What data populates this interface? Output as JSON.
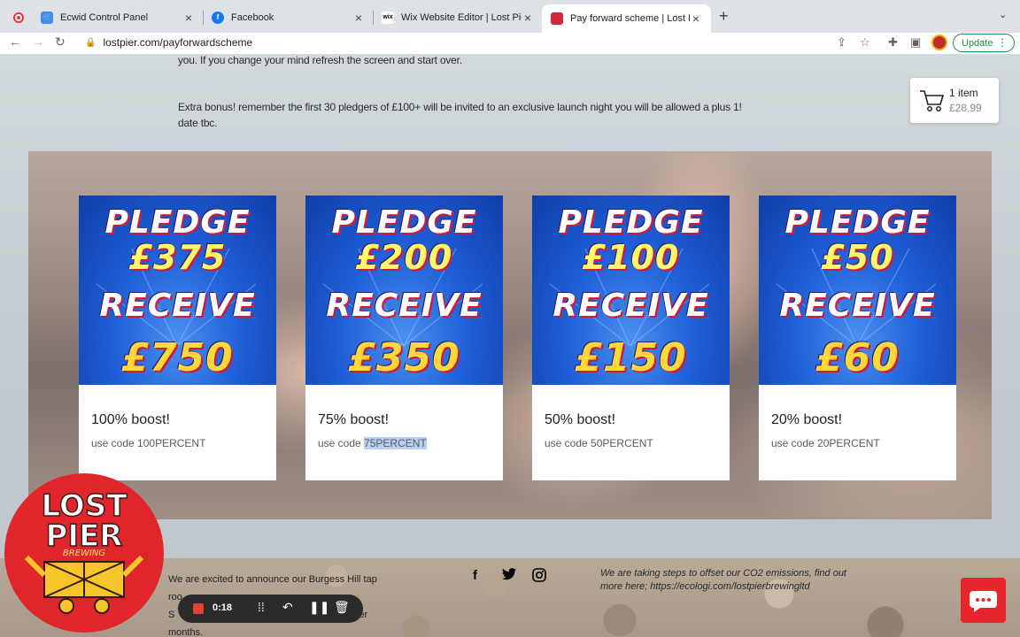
{
  "browser": {
    "tabs": [
      {
        "title": "Ecwid Control Panel",
        "favicon": "ecwid-icon",
        "color": "#3d8ef0"
      },
      {
        "title": "Facebook",
        "favicon": "facebook-icon",
        "color": "#1877f2"
      },
      {
        "title": "Wix Website Editor | Lost Pier Brewing",
        "favicon": "wix-icon",
        "color": "#000000"
      },
      {
        "title": "Pay forward scheme | Lost Pier",
        "favicon": "lostpier-icon",
        "color": "#d2263a"
      }
    ],
    "url": "lostpier.com/payforwardscheme",
    "update_label": "Update"
  },
  "page": {
    "intro_line": "you. If you change your mind refresh the screen and start over.",
    "bonus_text": "Extra bonus! remember the first 30 pledgers of £100+ will be invited to an exclusive launch night you will be allowed a plus 1! date tbc.",
    "cart": {
      "count": "1 item",
      "total": "£28.99"
    },
    "cards": [
      {
        "pledge_word": "PLEDGE",
        "pledge_amount": "£375",
        "receive_word": "RECEIVE",
        "receive_amount": "£750",
        "boost": "100% boost!",
        "code_prefix": "use code ",
        "code": "100PERCENT",
        "highlighted": false
      },
      {
        "pledge_word": "PLEDGE",
        "pledge_amount": "£200",
        "receive_word": "RECEIVE",
        "receive_amount": "£350",
        "boost": "75% boost!",
        "code_prefix": "use code ",
        "code": "75PERCENT",
        "highlighted": true
      },
      {
        "pledge_word": "PLEDGE",
        "pledge_amount": "£100",
        "receive_word": "RECEIVE",
        "receive_amount": "£150",
        "boost": "50% boost!",
        "code_prefix": "use code ",
        "code": "50PERCENT",
        "highlighted": false
      },
      {
        "pledge_word": "PLEDGE",
        "pledge_amount": "£50",
        "receive_word": "RECEIVE",
        "receive_amount": "£60",
        "boost": "20% boost!",
        "code_prefix": "use code ",
        "code": "20PERCENT",
        "highlighted": false
      }
    ],
    "footer": {
      "left_lines": [
        "We are excited to announce our Burgess Hill tap",
        "roo",
        "S",
        "months."
      ],
      "left_line3_tail": "ter",
      "right_text": "We are taking steps to offset our CO2 emissions, find out more here; https://ecologi.com/lostpierbrewingltd",
      "socials": [
        "facebook-icon",
        "twitter-icon",
        "instagram-icon"
      ]
    },
    "logo": {
      "line1": "LOST",
      "line2": "PIER",
      "line3": "BREWING"
    }
  },
  "recorder": {
    "time": "0:18"
  },
  "colors": {
    "accent_red": "#e8262b",
    "update_green": "#1e8e3e",
    "highlight": "#b7cff3"
  }
}
